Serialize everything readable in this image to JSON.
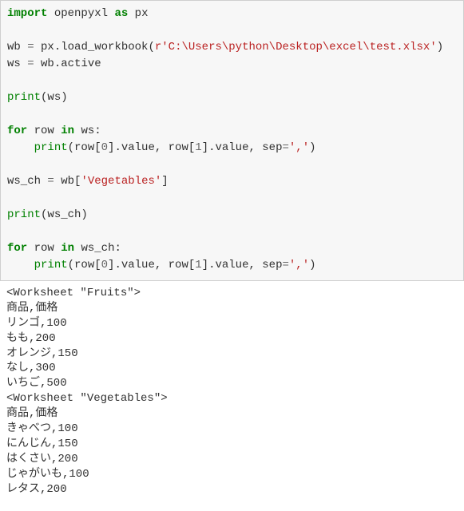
{
  "code": {
    "l1_import": "import",
    "l1_mod": "openpyxl",
    "l1_as": "as",
    "l1_alias": "px",
    "l3_wb": "wb",
    "l3_eq": "=",
    "l3_call": "px.load_workbook(",
    "l3_str": "r'C:\\Users\\python\\Desktop\\excel\\test.xlsx'",
    "l3_close": ")",
    "l4_ws": "ws",
    "l4_eq": "=",
    "l4_expr": "wb.active",
    "l6_print": "print",
    "l6_args": "(ws)",
    "l8_for": "for",
    "l8_row": "row",
    "l8_in": "in",
    "l8_iter": "ws:",
    "l9_print": "print",
    "l9_open": "(row[",
    "l9_0": "0",
    "l9_mid1": "].value, row[",
    "l9_1": "1",
    "l9_mid2": "].value, sep",
    "l9_eq": "=",
    "l9_sep": "','",
    "l9_close": ")",
    "l11_wsch": "ws_ch",
    "l11_eq": "=",
    "l11_wb": "wb[",
    "l11_key": "'Vegetables'",
    "l11_close": "]",
    "l13_print": "print",
    "l13_args": "(ws_ch)",
    "l15_for": "for",
    "l15_row": "row",
    "l15_in": "in",
    "l15_iter": "ws_ch:",
    "l16_print": "print",
    "l16_open": "(row[",
    "l16_0": "0",
    "l16_mid1": "].value, row[",
    "l16_1": "1",
    "l16_mid2": "].value, sep",
    "l16_eq": "=",
    "l16_sep": "','",
    "l16_close": ")"
  },
  "output": {
    "o1": "<Worksheet \"Fruits\">",
    "o2": "商品,価格",
    "o3": "リンゴ,100",
    "o4": "もも,200",
    "o5": "オレンジ,150",
    "o6": "なし,300",
    "o7": "いちご,500",
    "o8": "<Worksheet \"Vegetables\">",
    "o9": "商品,価格",
    "o10": "きゃべつ,100",
    "o11": "にんじん,150",
    "o12": "はくさい,200",
    "o13": "じゃがいも,100",
    "o14": "レタス,200"
  }
}
